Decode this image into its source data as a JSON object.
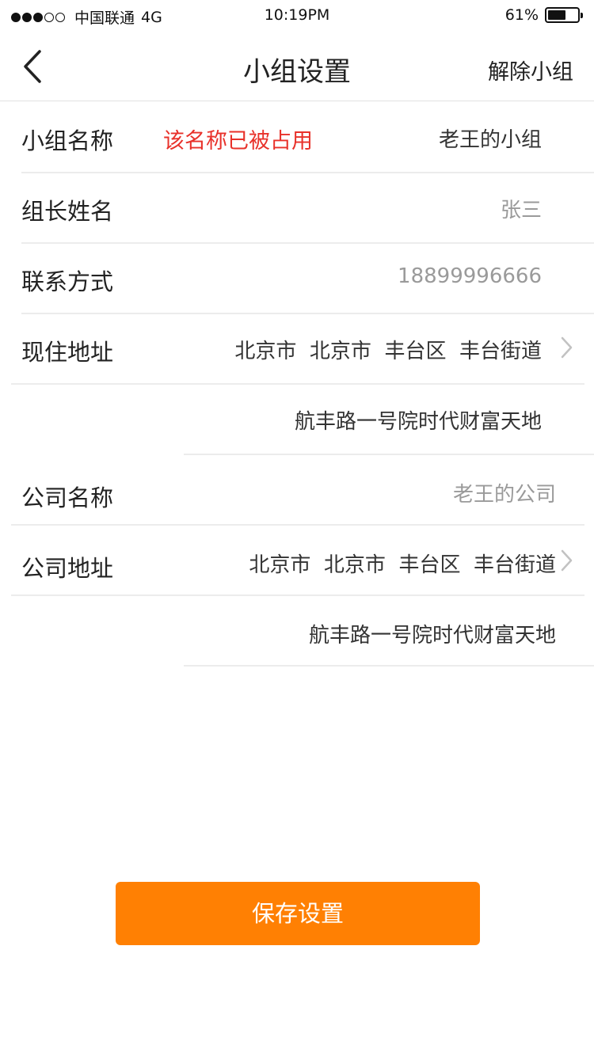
{
  "status_bar": {
    "carrier": "中国联通",
    "network": "4G",
    "time": "10:19PM",
    "battery_text": "61%",
    "battery_level": 0.61,
    "signal_strength": 3,
    "signal_max": 5
  },
  "nav": {
    "back_icon": "chevron-left-icon",
    "title": "小组设置",
    "action_label": "解除小组"
  },
  "form": {
    "group_name": {
      "label": "小组名称",
      "error": "该名称已被占用",
      "value": "老王的小组"
    },
    "leader_name": {
      "label": "组长姓名",
      "value": "张三"
    },
    "contact": {
      "label": "联系方式",
      "value": "18899996666"
    },
    "current_address": {
      "label": "现住地址",
      "region": "北京市  北京市  丰台区  丰台街道",
      "detail": "航丰路一号院时代财富天地"
    },
    "company_name": {
      "label": "公司名称",
      "value": "老王的公司"
    },
    "company_address": {
      "label": "公司地址",
      "region": "北京市  北京市  丰台区  丰台街道",
      "detail": "航丰路一号院时代财富天地"
    }
  },
  "save_button": {
    "label": "保存设置",
    "color": "#ff8003"
  },
  "colors": {
    "error": "#e8312a",
    "accent": "#ff8003",
    "muted_text": "#9a9a9a"
  }
}
